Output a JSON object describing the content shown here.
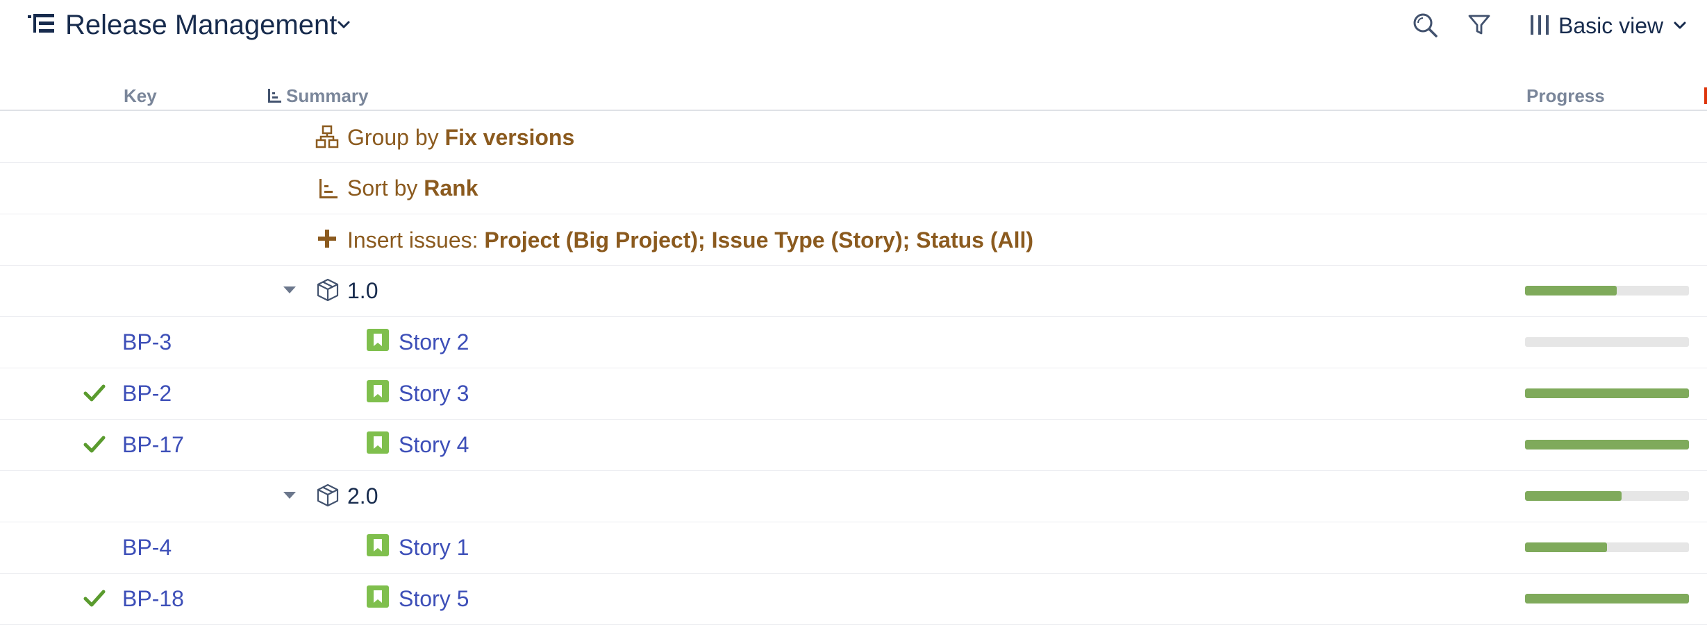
{
  "header": {
    "title": "Release Management",
    "icons": {
      "app": "structure-icon",
      "title_chevron": "chevron-down-icon",
      "search": "search-icon",
      "filter": "filter-icon",
      "view_columns": "columns-icon"
    },
    "view_label": "Basic view"
  },
  "columns": {
    "key": "Key",
    "summary": "Summary",
    "progress": "Progress"
  },
  "generators": [
    {
      "prefix": "Group by ",
      "value": "Fix versions",
      "icon": "group-icon"
    },
    {
      "prefix": "Sort by ",
      "value": "Rank",
      "icon": "sort-icon"
    },
    {
      "prefix": "Insert issues: ",
      "value": "Project (Big Project); Issue Type (Story); Status (All)",
      "icon": "plus-icon"
    }
  ],
  "rows": [
    {
      "type": "version",
      "label": "1.0",
      "progress": 0.56
    },
    {
      "type": "issue",
      "key": "BP-3",
      "summary": "Story 2",
      "done": false,
      "progress": 0.0
    },
    {
      "type": "issue",
      "key": "BP-2",
      "summary": "Story 3",
      "done": true,
      "progress": 1.0
    },
    {
      "type": "issue",
      "key": "BP-17",
      "summary": "Story 4",
      "done": true,
      "progress": 1.0
    },
    {
      "type": "version",
      "label": "2.0",
      "progress": 0.59
    },
    {
      "type": "issue",
      "key": "BP-4",
      "summary": "Story 1",
      "done": false,
      "progress": 0.5
    },
    {
      "type": "issue",
      "key": "BP-18",
      "summary": "Story 5",
      "done": true,
      "progress": 1.0
    }
  ],
  "colors": {
    "accent_brown": "#8B5A1E",
    "link_blue": "#3D4FB8",
    "progress_green": "#7FAA5B",
    "check_green": "#5A9B2E",
    "story_green": "#7FBF4D"
  }
}
